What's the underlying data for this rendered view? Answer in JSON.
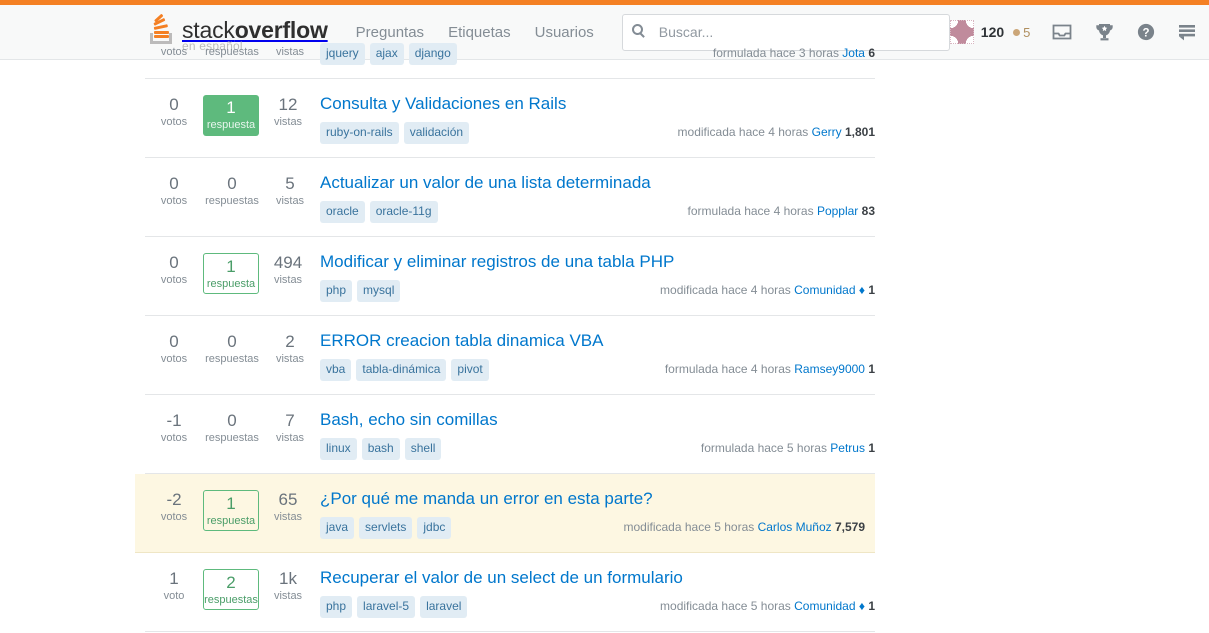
{
  "header": {
    "logo": {
      "stack": "stack",
      "overflow": "overflow",
      "subtitle": "en español"
    },
    "nav": [
      {
        "label": "Preguntas",
        "name": "nav-preguntas"
      },
      {
        "label": "Etiquetas",
        "name": "nav-etiquetas"
      },
      {
        "label": "Usuarios",
        "name": "nav-usuarios"
      }
    ],
    "search": {
      "placeholder": "Buscar...",
      "value": ""
    },
    "user": {
      "reputation": "120",
      "bronze_badges": "5"
    },
    "icons": [
      "inbox-icon",
      "achievements-trophy-icon",
      "help-icon",
      "site-switcher-icon"
    ],
    "colors": {
      "topbar": "#f48024",
      "background": "#f8f9f9",
      "link": "#0077cc",
      "tag_bg": "#e1ecf4",
      "tag_text": "#39739d",
      "accepted_green": "#5eba7d",
      "highlight_bg": "#fdf7e2"
    }
  },
  "stat_labels": {
    "votes_plural": "votos",
    "votes_singular": "voto",
    "answers_plural": "respuestas",
    "answers_singular": "respuesta",
    "views": "vistas"
  },
  "questions": [
    {
      "votes": "",
      "votes_label": "votos",
      "answers": "",
      "answers_label": "respuestas",
      "views": "",
      "views_label": "vistas",
      "title": "",
      "tags": [
        "jquery",
        "ajax",
        "django"
      ],
      "action": "formulada hace 3 horas",
      "user": "Jota",
      "rep": "6",
      "moderator": false,
      "answer_state": "none",
      "highlight": false,
      "clipped": true
    },
    {
      "votes": "0",
      "votes_label": "votos",
      "answers": "1",
      "answers_label": "respuesta",
      "views": "12",
      "views_label": "vistas",
      "title": "Consulta y Validaciones en Rails",
      "tags": [
        "ruby-on-rails",
        "validación"
      ],
      "action": "modificada hace 4 horas",
      "user": "Gerry",
      "rep": "1,801",
      "moderator": false,
      "answer_state": "accepted",
      "highlight": false,
      "clipped": false
    },
    {
      "votes": "0",
      "votes_label": "votos",
      "answers": "0",
      "answers_label": "respuestas",
      "views": "5",
      "views_label": "vistas",
      "title": "Actualizar un valor de una lista determinada",
      "tags": [
        "oracle",
        "oracle-11g"
      ],
      "action": "formulada hace 4 horas",
      "user": "Popplar",
      "rep": "83",
      "moderator": false,
      "answer_state": "none",
      "highlight": false,
      "clipped": false
    },
    {
      "votes": "0",
      "votes_label": "votos",
      "answers": "1",
      "answers_label": "respuesta",
      "views": "494",
      "views_label": "vistas",
      "title": "Modificar y eliminar registros de una tabla PHP",
      "tags": [
        "php",
        "mysql"
      ],
      "action": "modificada hace 4 horas",
      "user": "Comunidad",
      "rep": "1",
      "moderator": true,
      "answer_state": "answered",
      "highlight": false,
      "clipped": false
    },
    {
      "votes": "0",
      "votes_label": "votos",
      "answers": "0",
      "answers_label": "respuestas",
      "views": "2",
      "views_label": "vistas",
      "title": "ERROR creacion tabla dinamica VBA",
      "tags": [
        "vba",
        "tabla-dinámica",
        "pivot"
      ],
      "action": "formulada hace 4 horas",
      "user": "Ramsey9000",
      "rep": "1",
      "moderator": false,
      "answer_state": "none",
      "highlight": false,
      "clipped": false
    },
    {
      "votes": "-1",
      "votes_label": "votos",
      "answers": "0",
      "answers_label": "respuestas",
      "views": "7",
      "views_label": "vistas",
      "title": "Bash, echo sin comillas",
      "tags": [
        "linux",
        "bash",
        "shell"
      ],
      "action": "formulada hace 5 horas",
      "user": "Petrus",
      "rep": "1",
      "moderator": false,
      "answer_state": "none",
      "highlight": false,
      "clipped": false
    },
    {
      "votes": "-2",
      "votes_label": "votos",
      "answers": "1",
      "answers_label": "respuesta",
      "views": "65",
      "views_label": "vistas",
      "title": "¿Por qué me manda un error en esta parte?",
      "tags": [
        "java",
        "servlets",
        "jdbc"
      ],
      "action": "modificada hace 5 horas",
      "user": "Carlos Muñoz",
      "rep": "7,579",
      "moderator": false,
      "answer_state": "answered",
      "highlight": true,
      "clipped": false
    },
    {
      "votes": "1",
      "votes_label": "voto",
      "answers": "2",
      "answers_label": "respuestas",
      "views": "1k",
      "views_label": "vistas",
      "title": "Recuperar el valor de un select de un formulario",
      "tags": [
        "php",
        "laravel-5",
        "laravel"
      ],
      "action": "modificada hace 5 horas",
      "user": "Comunidad",
      "rep": "1",
      "moderator": true,
      "answer_state": "answered",
      "highlight": false,
      "clipped": false
    }
  ]
}
